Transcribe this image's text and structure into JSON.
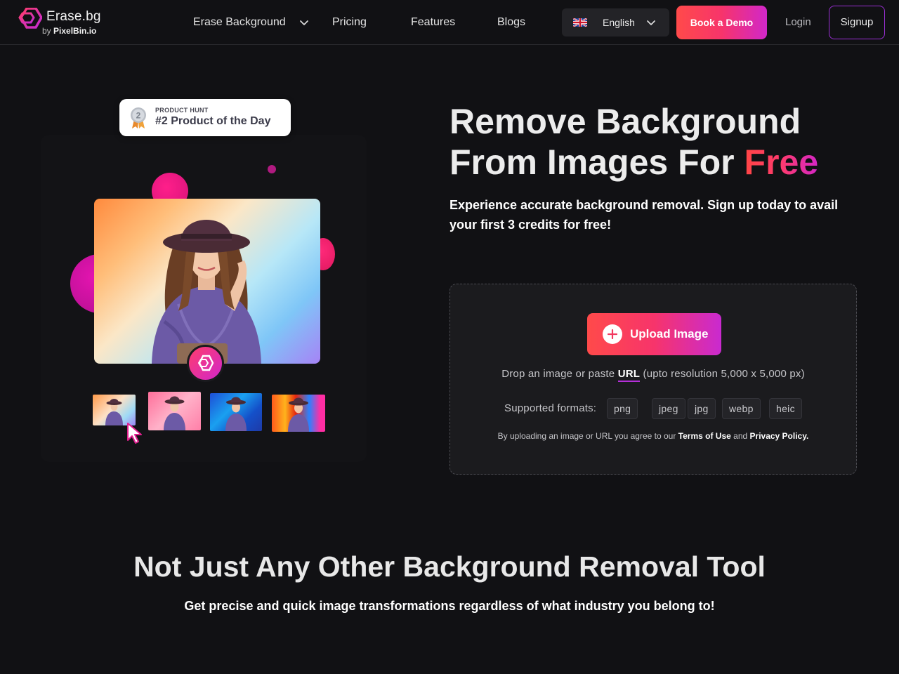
{
  "header": {
    "logo": {
      "name": "Erase.bg",
      "by_prefix": "by",
      "by_brand": "PixelBin.io"
    },
    "nav": [
      {
        "label": "Erase Background",
        "has_dropdown": true
      },
      {
        "label": "Pricing"
      },
      {
        "label": "Features"
      },
      {
        "label": "Blogs"
      }
    ],
    "language": {
      "selected": "English",
      "flag_icon": "uk-flag-icon"
    },
    "demo_label": "Book a Demo",
    "login_label": "Login",
    "signup_label": "Signup"
  },
  "hero": {
    "badge": {
      "top": "PRODUCT HUNT",
      "main": "#2 Product of the Day",
      "medal_number": "2"
    },
    "title_line1": "Remove Background",
    "title_line2_prefix": "From Images For ",
    "title_highlight": "Free",
    "subtitle": "Experience accurate background removal. Sign up today to avail your first 3 credits for free!"
  },
  "upload": {
    "button_label": "Upload Image",
    "drop_prefix": "Drop an image or paste ",
    "drop_url": "URL",
    "drop_suffix": " (upto resolution 5,000 x 5,000 px)",
    "formats_label": "Supported formats:",
    "formats": [
      "png",
      "jpeg",
      "jpg",
      "webp",
      "heic"
    ],
    "terms_prefix": "By uploading an image or URL you agree to our ",
    "terms_link": "Terms of Use",
    "terms_mid": " and ",
    "privacy_link": "Privacy Policy."
  },
  "section2": {
    "title": "Not Just Any Other Background Removal Tool",
    "subtitle": "Get precise and quick image transformations regardless of what industry you belong to!"
  },
  "colors": {
    "background": "#111114",
    "accent_start": "#ff4a4a",
    "accent_mid": "#f7346b",
    "accent_end": "#d127c9",
    "panel": "#1b1b1e"
  }
}
